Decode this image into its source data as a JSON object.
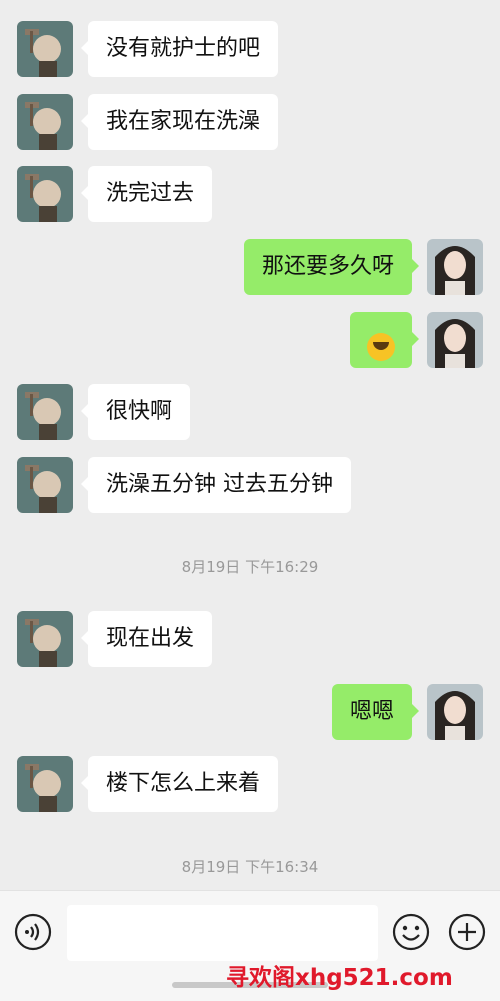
{
  "messages": [
    {
      "side": "left",
      "text": "没有就护士的吧"
    },
    {
      "side": "left",
      "text": "我在家现在洗澡"
    },
    {
      "side": "left",
      "text": "洗完过去"
    },
    {
      "side": "right",
      "text": "那还要多久呀"
    },
    {
      "side": "right",
      "emoji": "laughing-emoji"
    },
    {
      "side": "left",
      "text": "很快啊"
    },
    {
      "side": "left",
      "text": "洗澡五分钟 过去五分钟"
    },
    {
      "side": "left",
      "text": "现在出发"
    },
    {
      "side": "right",
      "text": "嗯嗯"
    },
    {
      "side": "left",
      "text": "楼下怎么上来着"
    }
  ],
  "timestamps": [
    "8月19日 下午16:29",
    "8月19日 下午16:34"
  ],
  "input_bar": {
    "voice_icon": "voice-icon",
    "emoji_icon": "emoji-icon",
    "plus_icon": "plus-icon",
    "input_value": ""
  },
  "watermark": "寻欢阁xhg521.com",
  "colors": {
    "sent_bubble": "#95ec69",
    "received_bubble": "#ffffff",
    "background": "#ededed"
  }
}
